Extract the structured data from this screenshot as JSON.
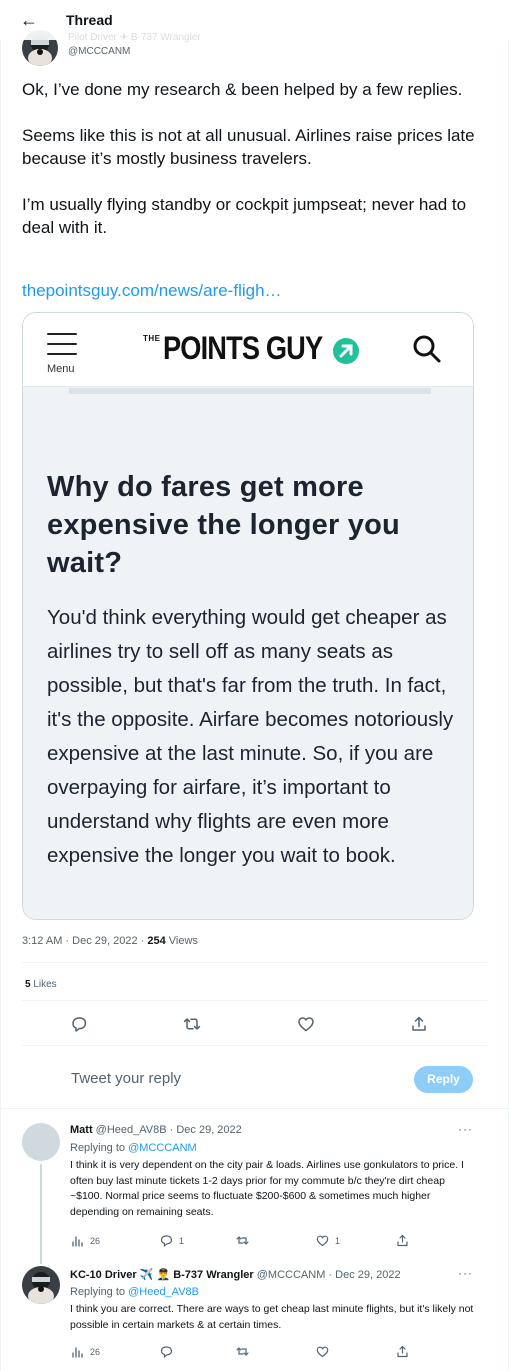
{
  "header": {
    "back_glyph": "←",
    "title": "Thread",
    "ghost_name": "Pilot Driver ✈ B-737 Wrangler"
  },
  "tweet": {
    "handle": "@MCCCANM",
    "text": "Ok, I’ve done my research & been helped by a few replies.\n\nSeems like this is not at all unusual. Airlines raise prices late because it’s mostly business travelers.\n\nI’m usually flying standby or cockpit jumpseat; never had to deal with it.",
    "link": "thepointsguy.com/news/are-fligh…",
    "time": "3:12 AM · Dec 29, 2022 · ",
    "views_count": "254",
    "views_label": " Views",
    "likes_count": "5",
    "likes_label": " Likes"
  },
  "card": {
    "menu_label": "Menu",
    "logo_the": "THE",
    "logo_text": "POINTS GUY",
    "heading": "Why do fares get more expensive the longer you wait?",
    "body": "You'd think everything would get cheaper as airlines try to sell off as many seats as possible, but that's far from the truth. In fact, it's the opposite. Airfare becomes notoriously expensive at the last minute. So, if you are overpaying for airfare, it’s important to understand why flights are even more expensive the longer you wait to book."
  },
  "actions": [
    "reply-icon",
    "retweet-icon",
    "like-icon",
    "share-icon"
  ],
  "compose": {
    "placeholder": "Tweet your reply",
    "button": "Reply"
  },
  "replies": [
    {
      "name": "Matt",
      "handle": "@Heed_AV8B · Dec 29, 2022",
      "replying_prefix": "Replying to ",
      "replying_to": "@MCCCANM",
      "text": "I think it is very dependent on the city pair & loads.  Airlines use gonkulators to price.  I often buy last minute tickets 1-2 days prior for my commute b/c they're dirt cheap ~$100.  Normal price seems to fluctuate $200-$600 & sometimes much higher depending on remaining seats.",
      "views": "26",
      "replies": "1",
      "retweets": "",
      "likes": "1"
    },
    {
      "name": "KC-10 Driver ✈️ 👨‍✈️ B-737 Wrangler",
      "handle": "@MCCCANM · Dec 29, 2022",
      "replying_prefix": "Replying to ",
      "replying_to": "@Heed_AV8B",
      "text": "I think you are correct. There are ways to get cheap last minute flights, but it's likely not possible in certain markets & at certain times.",
      "views": "26",
      "replies": "",
      "retweets": "",
      "likes": ""
    }
  ],
  "more_glyph": "···",
  "colors": {
    "accent": "#1d9bf0",
    "reply_button": "#8ecdf7",
    "logo_badge": "#1fc19b"
  }
}
